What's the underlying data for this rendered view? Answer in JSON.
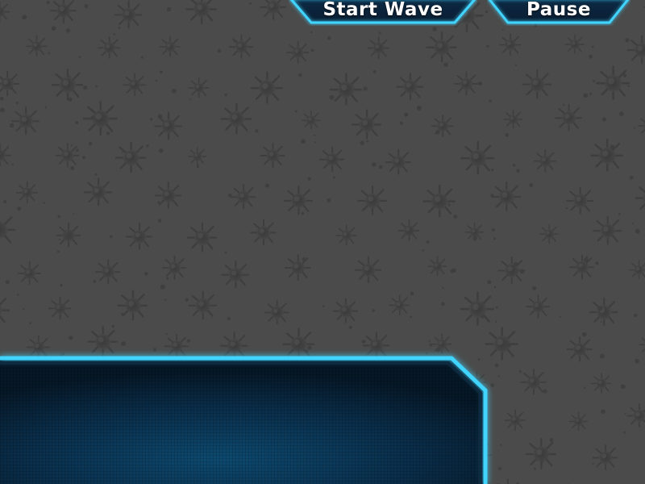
{
  "hud": {
    "start_wave_label": "Start Wave",
    "pause_label": "Pause"
  },
  "colors": {
    "background": "#4b4b4b",
    "accent_glow": "#3fd4ff",
    "panel_dark": "#061726",
    "panel_mid": "#0b3a5c"
  }
}
